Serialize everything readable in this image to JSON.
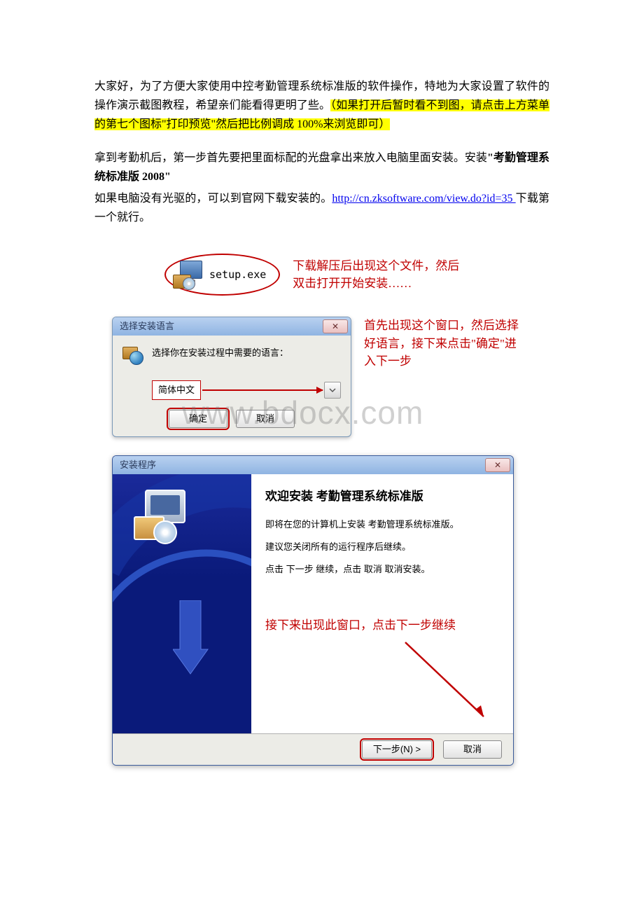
{
  "intro": {
    "p1_a": "大家好，为了方便大家使用中控考勤管理系统标准版的软件操作，特地为大家设置了软件的操作演示截图教程，希望亲们能看得更明了些。",
    "p1_hl": "（如果打开后暂时看不到图，请点击上方菜单的第七个图标\"打印预览\"然后把比例调成 100%来浏览即可）",
    "p2_a": "拿到考勤机后，第一步首先要把里面标配的光盘拿出来放入电脑里面安装。安装",
    "p2_bold": "\"考勤管理系统标准版 2008\"",
    "p3_a": "如果电脑没有光驱的，可以到官网下载安装的。",
    "p3_link": "http://cn.zksoftware.com/view.do?id=35 ",
    "p3_b": "下载第一个就行。"
  },
  "fig1": {
    "filename": "setup.exe",
    "caption_l1": "下载解压后出现这个文件，然后",
    "caption_l2": "双击打开开始安装……"
  },
  "fig2": {
    "title": "选择安装语言",
    "close": "✕",
    "prompt": "选择你在安装过程中需要的语言：",
    "selected": "简体中文",
    "ok": "确定",
    "cancel": "取消",
    "caption": "首先出现这个窗口，然后选择好语言，接下来点击\"确定\"进入下一步",
    "watermark": "www.bdocx.com"
  },
  "fig3": {
    "title": "安装程序",
    "close": "✕",
    "heading": "欢迎安装 考勤管理系统标准版",
    "line1": "即将在您的计算机上安装 考勤管理系统标准版。",
    "line2": "建议您关闭所有的运行程序后继续。",
    "line3": "点击 下一步 继续，点击 取消 取消安装。",
    "annot": "接下来出现此窗口，点击下一步继续",
    "next": "下一步(N) >",
    "cancel": "取消"
  }
}
